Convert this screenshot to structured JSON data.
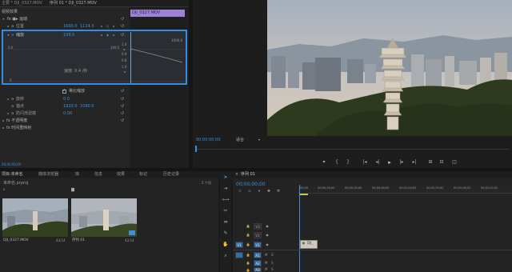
{
  "effect_controls": {
    "tabs": [
      "主要 * DJI_0327.MOV",
      "序列 01 * DJI_0327.MOV"
    ],
    "section_label": "视频效果",
    "clip_bar_label": "DJI_0327.MOV",
    "rows": [
      {
        "label": "fx ▣▸ 运动"
      },
      {
        "label": "位置",
        "v1": "1600.0",
        "v2": "1114.3"
      },
      {
        "label": "缩放",
        "v1": "109.5"
      },
      {
        "label": "旋转",
        "v1": "0.0"
      },
      {
        "label": "锚点",
        "v1": "1920.0",
        "v2": "1080.0"
      },
      {
        "label": "防闪烁滤镜",
        "v1": "0.00"
      },
      {
        "label": "fx 不透明度"
      },
      {
        "label": "fx 时间重映射"
      }
    ],
    "graph": {
      "left_val": "0.0",
      "right_val": "109.5",
      "top_val": "1000.0",
      "velocity_label": "速度: 0.4 /秒",
      "right_scale": [
        "1.0",
        "0.9",
        "0.8",
        "1.0",
        "0.0",
        "0.0"
      ],
      "bottom_left": "0"
    },
    "uniform_scale_label": "等比缩放",
    "checkbox_mark": "✓",
    "bottom_text": "00;00;00;00"
  },
  "program_monitor": {
    "timecode": "00;00;00;00",
    "fit_label": "适合",
    "controls": [
      "▾",
      "{",
      "}",
      "|◂",
      "◂|",
      "▸",
      "|▸",
      "▸|",
      "⊞",
      "⊟",
      "◫"
    ]
  },
  "project_panel": {
    "tabs": [
      "项目:未命名",
      "媒体浏览器",
      "库",
      "信息",
      "效果",
      "标记",
      "历史记录"
    ],
    "project_file": "未命名.prproj",
    "item_count": "2 个项",
    "items": [
      {
        "name": "DJI_0327.MOV",
        "duration": "43;14"
      },
      {
        "name": "序列 01",
        "duration": "43;14"
      }
    ]
  },
  "timeline": {
    "title": "序列 01",
    "timecode": "00;00;00;00",
    "ruler": [
      "00;00",
      "00;00;16;00",
      "00;00;32;00",
      "00;00;48;00",
      "00;01;04;02",
      "00;01;20;02",
      "00;01;36;02",
      "00;01;52;02"
    ],
    "video_tracks": [
      "V3",
      "V2",
      "V1"
    ],
    "audio_tracks": [
      "A1",
      "A2",
      "A3"
    ],
    "track_buttons": [
      "M",
      "S"
    ],
    "clip_label": "DJI_",
    "source_label": "V1"
  },
  "colors": {
    "accent_blue": "#2f8fe6",
    "clip_purple": "#9d82d6",
    "timecode_blue": "#3e8fd8"
  }
}
